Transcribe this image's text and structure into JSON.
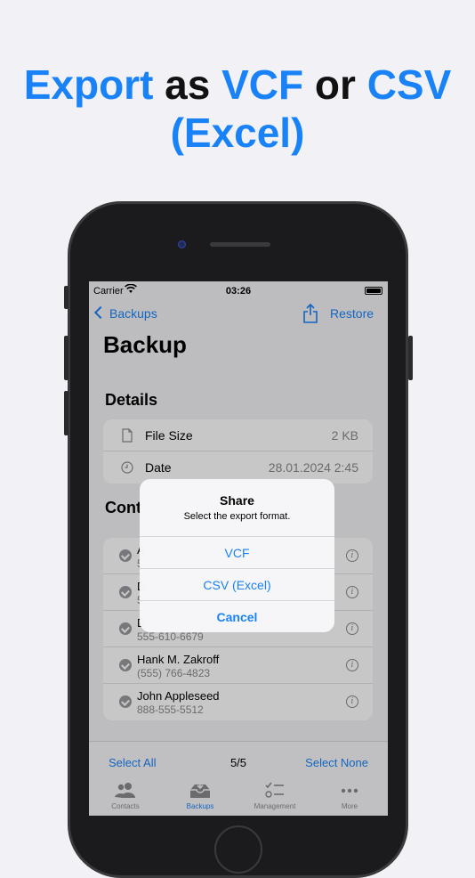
{
  "headline": {
    "part1": "Export",
    "part2": " as ",
    "part3": "VCF",
    "part4": " or ",
    "part5": "CSV",
    "part6": "(Excel)"
  },
  "status_bar": {
    "carrier": "Carrier",
    "time": "03:26"
  },
  "nav": {
    "back_label": "Backups",
    "restore_label": "Restore"
  },
  "page_title": "Backup",
  "details": {
    "section_title": "Details",
    "rows": [
      {
        "label": "File Size",
        "value": "2 KB"
      },
      {
        "label": "Date",
        "value": "28.01.2024 2:45"
      }
    ]
  },
  "contacts": {
    "section_title": "Cont",
    "items": [
      {
        "name": "A",
        "phone": "5"
      },
      {
        "name": "D",
        "phone": "5"
      },
      {
        "name": "D",
        "phone": "555-610-6679"
      },
      {
        "name": "Hank M. Zakroff",
        "phone": "(555) 766-4823"
      },
      {
        "name": "John Appleseed",
        "phone": "888-555-5512"
      }
    ]
  },
  "toolbar": {
    "select_all": "Select All",
    "count": "5/5",
    "select_none": "Select None"
  },
  "tabs": [
    {
      "label": "Contacts",
      "icon": "contacts-icon"
    },
    {
      "label": "Backups",
      "icon": "backups-icon"
    },
    {
      "label": "Management",
      "icon": "management-icon"
    },
    {
      "label": "More",
      "icon": "more-icon"
    }
  ],
  "alert": {
    "title": "Share",
    "message": "Select the export format.",
    "buttons": [
      "VCF",
      "CSV (Excel)",
      "Cancel"
    ]
  },
  "colors": {
    "accent": "#1a82f7",
    "background": "#f2f2f6"
  }
}
